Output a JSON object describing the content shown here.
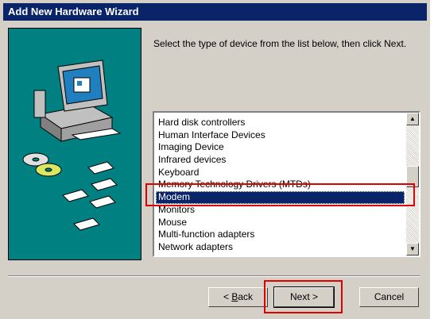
{
  "window": {
    "title": "Add New Hardware Wizard"
  },
  "prompt": "Select the type of device from the list below, then click Next.",
  "device_list": {
    "items": [
      "Hard disk controllers",
      "Human Interface Devices",
      "Imaging Device",
      "Infrared devices",
      "Keyboard",
      "Memory Technology Drivers (MTDs)",
      "Modem",
      "Monitors",
      "Mouse",
      "Multi-function adapters",
      "Network adapters"
    ],
    "selected": "Modem"
  },
  "buttons": {
    "back_underline": "B",
    "back_rest": "ack",
    "back_prefix": "< ",
    "next": "Next >",
    "cancel": "Cancel"
  },
  "scrollbar": {
    "up_glyph": "▲",
    "down_glyph": "▼"
  },
  "colors": {
    "selection": "#0a246a",
    "highlight_box": "#e00000",
    "graphic_bg": "#008080"
  }
}
